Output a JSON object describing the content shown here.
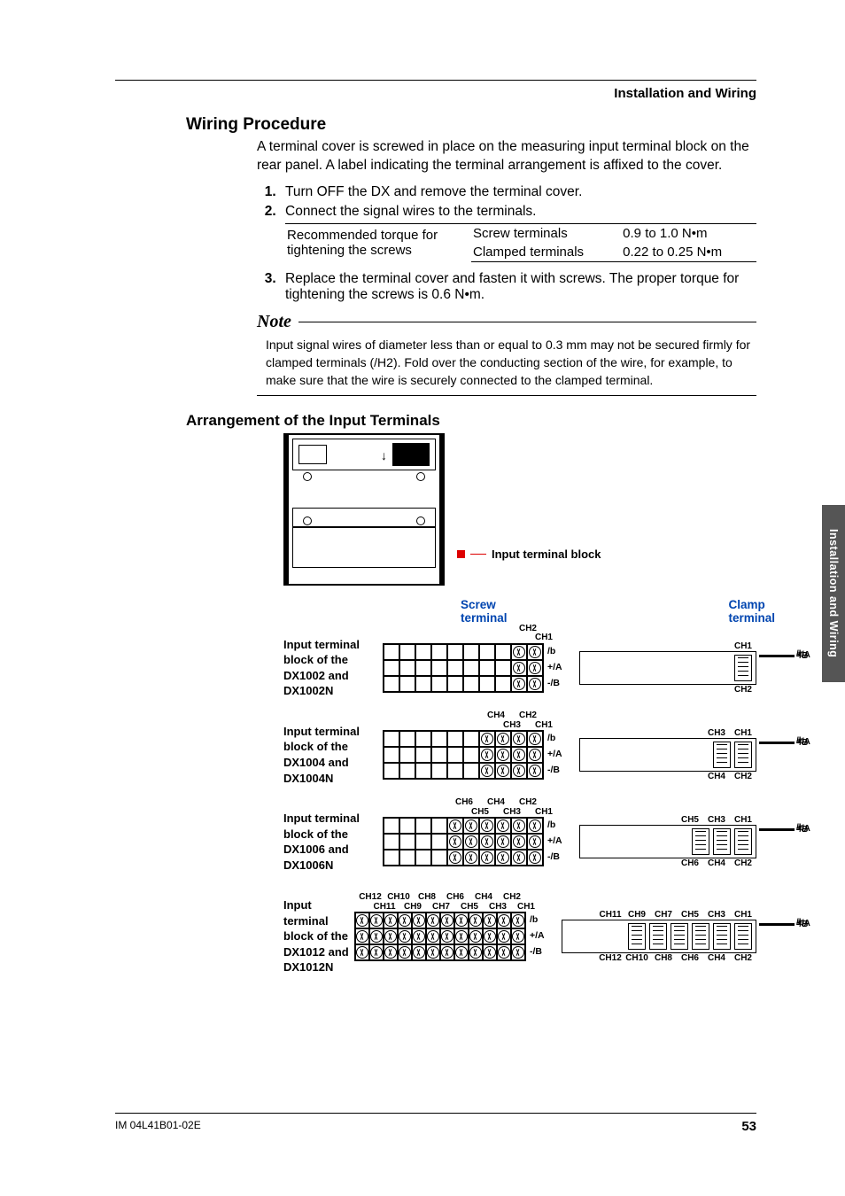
{
  "header": {
    "section": "Installation and Wiring"
  },
  "sidetab": "Installation and Wiring",
  "wiring": {
    "title": "Wiring Procedure",
    "intro": "A terminal cover is screwed in place on the measuring input terminal block on the rear panel. A label indicating the terminal arrangement is affixed to the cover.",
    "steps": [
      "Turn OFF the DX and remove the terminal cover.",
      "Connect the signal wires to the terminals.",
      "Replace the terminal cover and fasten it with screws. The proper torque for tightening the screws is 0.6 N•m."
    ],
    "torque": {
      "label": "Recommended torque for tightening the screws",
      "rows": [
        {
          "type": "Screw terminals",
          "value": "0.9 to 1.0 N•m"
        },
        {
          "type": "Clamped terminals",
          "value": "0.22 to 0.25 N•m"
        }
      ]
    },
    "note_title": "Note",
    "note": "Input signal wires of diameter less than or equal to 0.3 mm may not be secured firmly for clamped terminals (/H2). Fold over the conducting section of the wire, for example, to make sure that the wire is securely connected to the clamped terminal."
  },
  "arrangement": {
    "title": "Arrangement of the Input Terminals",
    "panel_label": "Input terminal block",
    "screw_head": "Screw terminal",
    "clamp_head": "Clamp terminal",
    "pins": [
      "/b",
      "+/A",
      "-/B"
    ],
    "blocks": [
      {
        "label": "Input terminal block of the DX1002 and DX1002N",
        "cols": 10,
        "filled_from_right": 2,
        "top_row": [
          "CH2"
        ],
        "bot_row": [
          "CH1"
        ],
        "clamp_pairs": 1
      },
      {
        "label": "Input terminal block of the DX1004 and DX1004N",
        "cols": 10,
        "filled_from_right": 4,
        "top_row": [
          "CH4",
          "CH2"
        ],
        "bot_row": [
          "CH3",
          "CH1"
        ],
        "clamp_pairs": 2
      },
      {
        "label": "Input terminal block of the DX1006 and DX1006N",
        "cols": 10,
        "filled_from_right": 6,
        "top_row": [
          "CH6",
          "CH4",
          "CH2"
        ],
        "bot_row": [
          "CH5",
          "CH3",
          "CH1"
        ],
        "clamp_pairs": 3
      },
      {
        "label": "Input terminal block of the DX1012 and DX1012N",
        "cols": 12,
        "filled_from_right": 12,
        "top_row": [
          "CH12",
          "CH10",
          "CH8",
          "CH6",
          "CH4",
          "CH2"
        ],
        "bot_row": [
          "CH11",
          "CH9",
          "CH7",
          "CH5",
          "CH3",
          "CH1"
        ],
        "clamp_pairs": 6
      }
    ]
  },
  "footer": {
    "doc": "IM 04L41B01-02E",
    "page": "53"
  }
}
